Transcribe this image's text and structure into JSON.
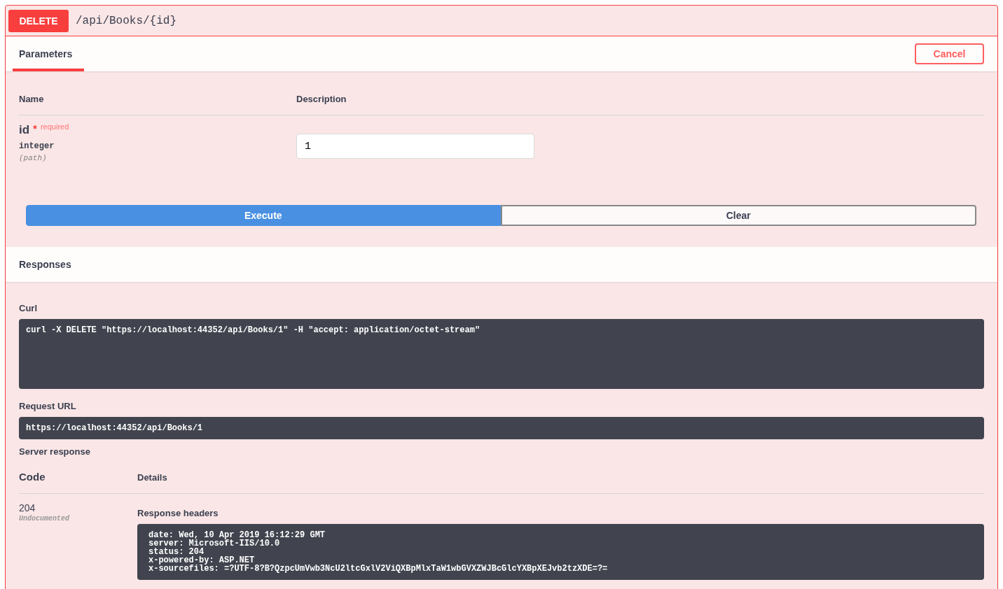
{
  "operation": {
    "method": "DELETE",
    "path": "/api/Books/{id}"
  },
  "parameters": {
    "tabs": [
      {
        "label": "Parameters",
        "selected": true
      }
    ],
    "cancel_button": "Cancel",
    "columns": [
      "Name",
      "Description"
    ],
    "rows": [
      {
        "name": "id",
        "required_mark": "*",
        "required_label": "required",
        "type": "integer",
        "location": "(path)",
        "value": "1"
      }
    ]
  },
  "actions": [
    {
      "label": "Execute",
      "kind": "primary"
    },
    {
      "label": "Clear",
      "kind": "secondary"
    }
  ],
  "responses": {
    "title": "Responses",
    "curl": {
      "label": "Curl",
      "command": "curl -X DELETE \"https://localhost:44352/api/Books/1\" -H \"accept: application/octet-stream\""
    },
    "request_url": {
      "label": "Request URL",
      "value": "https://localhost:44352/api/Books/1"
    },
    "server_response": {
      "label": "Server response",
      "columns": [
        "Code",
        "Details"
      ],
      "rows": [
        {
          "code": "204",
          "note": "Undocumented",
          "headers_label": "Response headers",
          "headers": [
            "date: Wed, 10 Apr 2019 16:12:29 GMT",
            "server: Microsoft-IIS/10.0",
            "status: 204",
            "x-powered-by: ASP.NET",
            "x-sourcefiles: =?UTF-8?B?QzpcUmVwb3NcU2ltcGxlV2ViQXBpMlxTaW1wbGVXZWJBcGlcYXBpXEJvb2tzXDE=?="
          ]
        }
      ]
    }
  }
}
